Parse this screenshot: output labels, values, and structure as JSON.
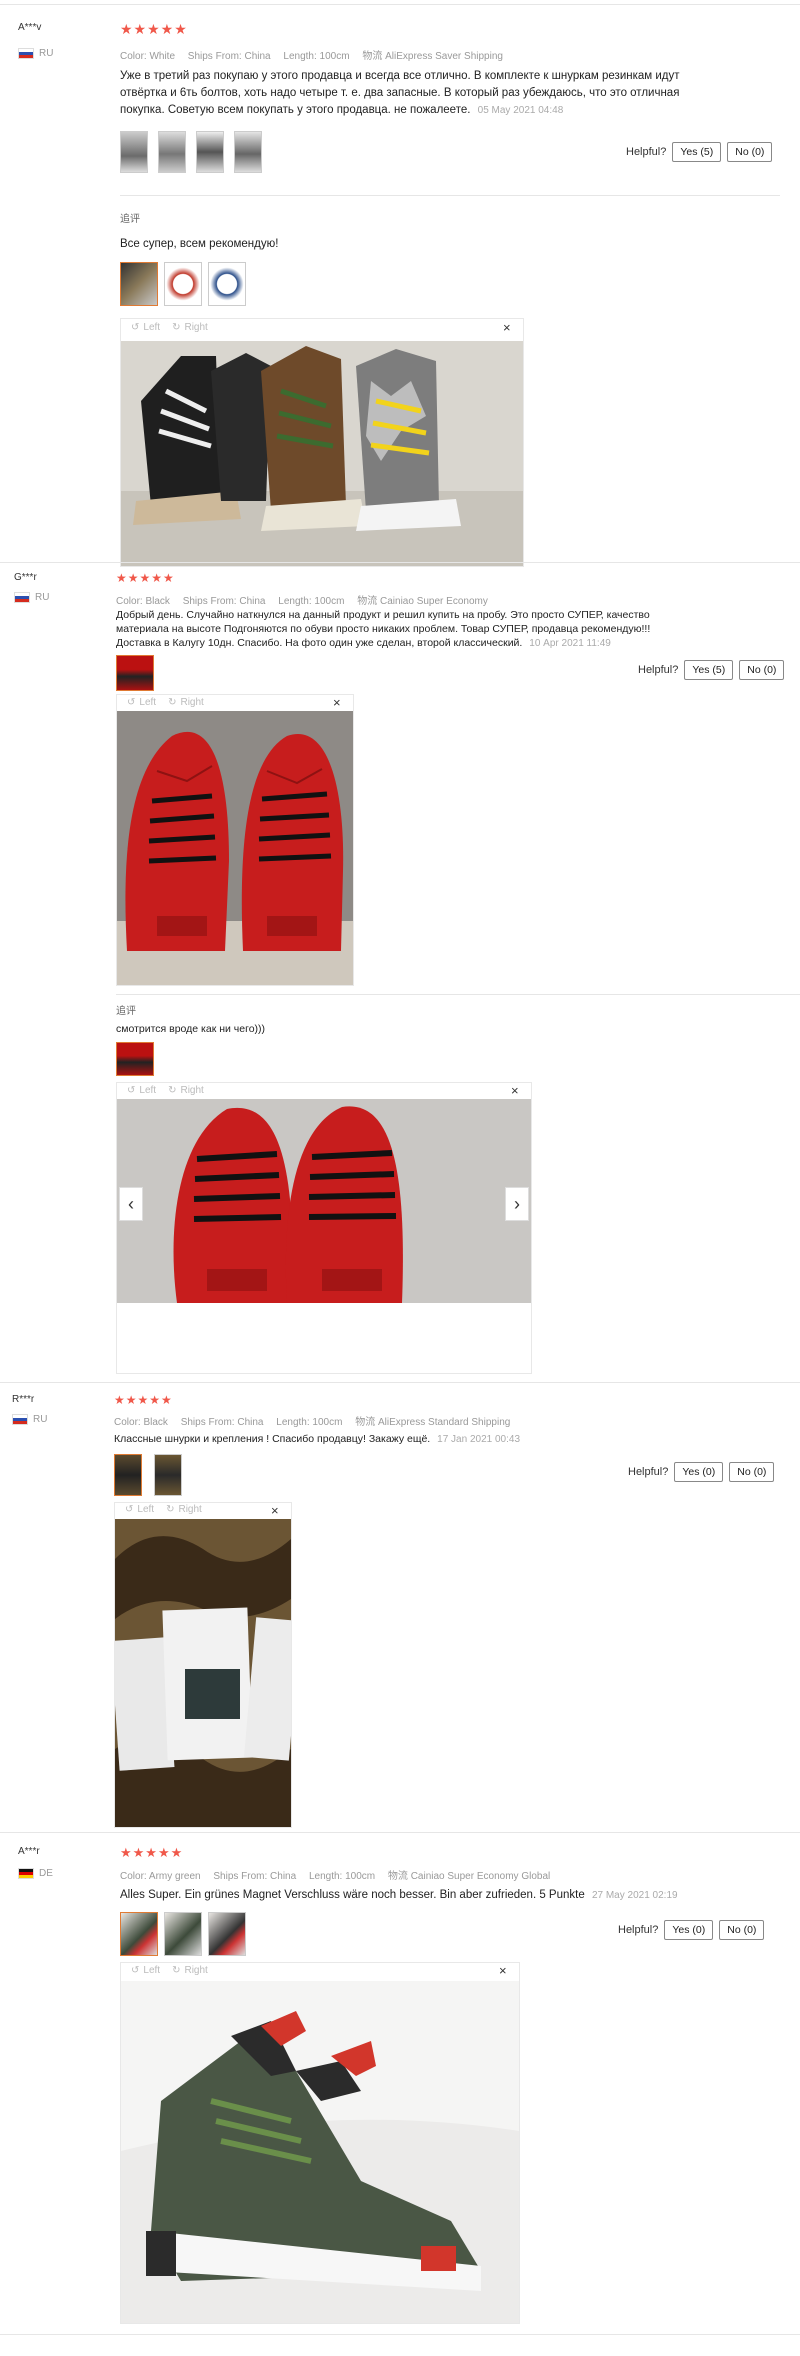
{
  "helpful_label": "Helpful?",
  "additional_label": "追评",
  "rotate_left": "Left",
  "rotate_right": "Right",
  "close_symbol": "×",
  "star_glyphs": "★★★★★",
  "reviews": [
    {
      "user": "A***v",
      "country": "RU",
      "color": "Color: White",
      "ships": "Ships From: China",
      "length": "Length: 100cm",
      "shipping": "物流 AliExpress Saver Shipping",
      "text": "Уже в третий раз покупаю у этого продавца и всегда все отлично. В комплекте к шнуркам резинкам идут отвёртка и 6ть болтов, хоть надо четыре т. е. два запасные. В который раз убеждаюсь, что это отличная покупка. Советую всем покупать у этого продавца. не пожалеете.",
      "date": "05 May 2021 04:48",
      "yes": "Yes (5)",
      "no": "No (0)",
      "additional_text": "Все супер, всем рекомендую!"
    },
    {
      "user": "G***r",
      "country": "RU",
      "color": "Color: Black",
      "ships": "Ships From: China",
      "length": "Length: 100cm",
      "shipping": "物流 Cainiao Super Economy",
      "text": "Добрый день. Случайно наткнулся на данный продукт и решил купить на пробу. Это просто СУПЕР, качество материала на высоте Подгоняются по обуви просто никаких проблем. Товар СУПЕР, продавца рекомендую!!! Доставка в Калугу 10дн. Спасибо. На фото один уже сделан, второй классический.",
      "date": "10 Apr 2021 11:49",
      "yes": "Yes (5)",
      "no": "No (0)",
      "additional_text": "смотрится вроде как ни чего)))"
    },
    {
      "user": "R***r",
      "country": "RU",
      "color": "Color: Black",
      "ships": "Ships From: China",
      "length": "Length: 100cm",
      "shipping": "物流 AliExpress Standard Shipping",
      "text": "Классные шнурки и крепления ! Спасибо продавцу! Закажу ещё.",
      "date": "17 Jan 2021 00:43",
      "yes": "Yes (0)",
      "no": "No (0)"
    },
    {
      "user": "A***r",
      "country": "DE",
      "color": "Color: Army green",
      "ships": "Ships From: China",
      "length": "Length: 100cm",
      "shipping": "物流 Cainiao Super Economy Global",
      "text": "Alles Super. Ein grünes Magnet Verschluss wäre noch besser. Bin aber zufrieden. 5 Punkte",
      "date": "27 May 2021 02:19",
      "yes": "Yes (0)",
      "no": "No (0)"
    }
  ]
}
